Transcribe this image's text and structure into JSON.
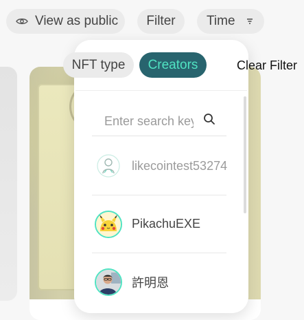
{
  "toolbar": {
    "view_as_public": "View as public",
    "filter": "Filter",
    "time": "Time",
    "icons": [
      "eye-icon",
      "sort-icon"
    ]
  },
  "filter_popover": {
    "tabs": [
      {
        "label": "NFT type",
        "active": false
      },
      {
        "label": "Creators",
        "active": true
      }
    ],
    "clear_filter": "Clear Filter",
    "search": {
      "placeholder": "Enter search keyword",
      "value": ""
    },
    "creators": [
      {
        "name": "likecointest53274",
        "avatar": "default-avatar-icon"
      },
      {
        "name": "PikachuEXE",
        "avatar": "pikachu-avatar"
      },
      {
        "name": "許明恩",
        "avatar": "person-avatar"
      }
    ]
  },
  "colors": {
    "accent_bg": "#28646e",
    "accent_text": "#50e3c2",
    "pill_bg": "#ebebeb",
    "page_bg": "#f7f7f7"
  }
}
